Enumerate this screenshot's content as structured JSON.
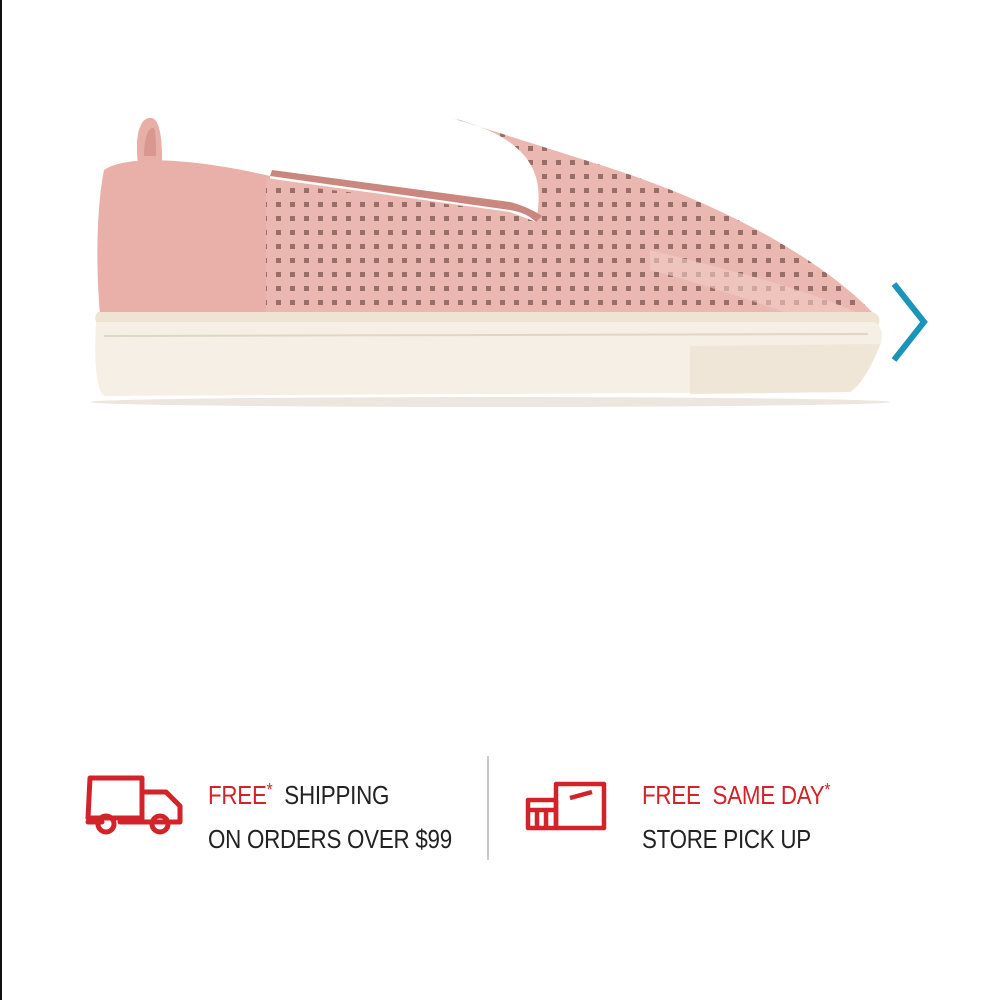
{
  "colors": {
    "accent": "#d3232a",
    "arrow": "#1a94b8",
    "text": "#222222",
    "shoe_upper": "#e9b4ad",
    "shoe_sole": "#f4ece1"
  },
  "carousel": {
    "next_icon": "chevron-right-icon",
    "product_image_alt": "pink perforated slip-on sneaker"
  },
  "benefits": {
    "shipping": {
      "icon": "delivery-truck-icon",
      "free_label": "FREE",
      "star": "*",
      "title_rest": "SHIPPING",
      "subtitle": "ON ORDERS OVER $99"
    },
    "pickup": {
      "icon": "store-pickup-icon",
      "free_label": "FREE",
      "same_day_label": "SAME DAY",
      "star": "*",
      "subtitle": "STORE PICK UP"
    }
  }
}
